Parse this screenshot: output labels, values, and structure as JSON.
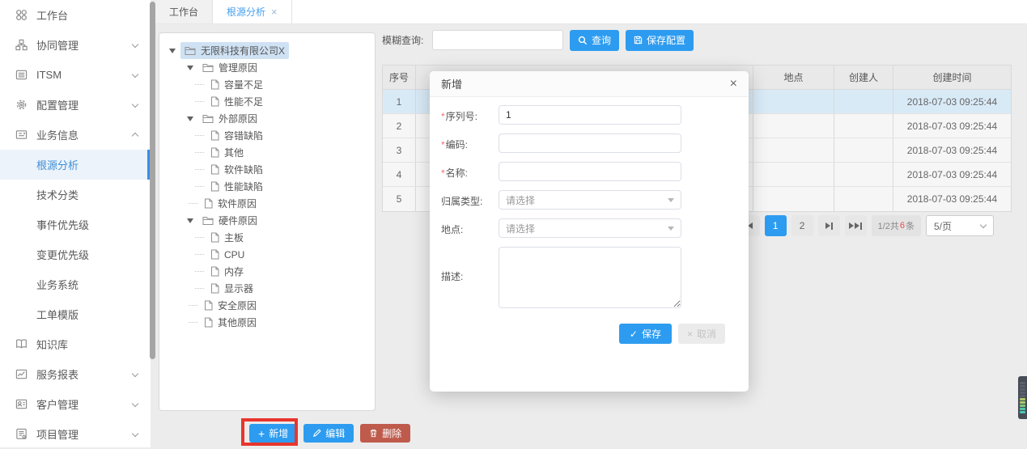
{
  "colors": {
    "accent": "#2d9cf0",
    "danger": "#bf5b4d",
    "annotation_red": "#e8352c",
    "active_blue": "#3d8fd8",
    "count_red": "#e84c4c"
  },
  "ui": {
    "required_mark": "*",
    "close": "×",
    "check": "✓",
    "cross": "×",
    "plus": "+"
  },
  "sidebar": {
    "items": [
      {
        "label": "工作台",
        "icon": "grid-icon"
      },
      {
        "label": "协同管理",
        "icon": "collab-icon",
        "chevron": "down"
      },
      {
        "label": "ITSM",
        "icon": "list-icon",
        "chevron": "down"
      },
      {
        "label": "配置管理",
        "icon": "gear-icon",
        "chevron": "down"
      },
      {
        "label": "业务信息",
        "icon": "business-icon",
        "chevron": "up",
        "expanded": true
      }
    ],
    "business_children": [
      "根源分析",
      "技术分类",
      "事件优先级",
      "变更优先级",
      "业务系统",
      "工单模版"
    ],
    "active_item": "根源分析",
    "tail_items": [
      {
        "label": "知识库",
        "icon": "book-icon"
      },
      {
        "label": "服务报表",
        "icon": "report-icon",
        "chevron": "down"
      },
      {
        "label": "客户管理",
        "icon": "customer-icon",
        "chevron": "down"
      },
      {
        "label": "项目管理",
        "icon": "project-icon",
        "chevron": "down"
      }
    ]
  },
  "tabs": {
    "first": "工作台",
    "active": "根源分析"
  },
  "tree": {
    "nodes": [
      {
        "label": "无限科技有限公司X",
        "type": "folder",
        "level": 0,
        "selected": true
      },
      {
        "label": "管理原因",
        "type": "folder",
        "level": 1
      },
      {
        "label": "容量不足",
        "type": "file",
        "level": 2
      },
      {
        "label": "性能不足",
        "type": "file",
        "level": 2
      },
      {
        "label": "外部原因",
        "type": "folder",
        "level": 1
      },
      {
        "label": "容错缺陷",
        "type": "file",
        "level": 2
      },
      {
        "label": "其他",
        "type": "file",
        "level": 2
      },
      {
        "label": "软件缺陷",
        "type": "file",
        "level": 2
      },
      {
        "label": "性能缺陷",
        "type": "file",
        "level": 2
      },
      {
        "label": "软件原因",
        "type": "file",
        "level": 1
      },
      {
        "label": "硬件原因",
        "type": "folder",
        "level": 1
      },
      {
        "label": "主板",
        "type": "file",
        "level": 2
      },
      {
        "label": "CPU",
        "type": "file",
        "level": 2
      },
      {
        "label": "内存",
        "type": "file",
        "level": 2
      },
      {
        "label": "显示器",
        "type": "file",
        "level": 2
      },
      {
        "label": "安全原因",
        "type": "file",
        "level": 1
      },
      {
        "label": "其他原因",
        "type": "file",
        "level": 1
      }
    ]
  },
  "tree_actions": {
    "add": "新增",
    "edit": "编辑",
    "remove": "删除"
  },
  "toolbar": {
    "search_label": "模糊查询:",
    "search_value": "",
    "query": "查询",
    "save_config": "保存配置"
  },
  "table": {
    "headers": {
      "seq": "序号",
      "location": "地点",
      "creator": "创建人",
      "created": "创建时间"
    },
    "rows": [
      {
        "seq": "1",
        "location": "",
        "creator": "",
        "created": "2018-07-03 09:25:44"
      },
      {
        "seq": "2",
        "location": "",
        "creator": "",
        "created": "2018-07-03 09:25:44"
      },
      {
        "seq": "3",
        "location": "",
        "creator": "",
        "created": "2018-07-03 09:25:44"
      },
      {
        "seq": "4",
        "location": "",
        "creator": "",
        "created": "2018-07-03 09:25:44"
      },
      {
        "seq": "5",
        "location": "",
        "creator": "",
        "created": "2018-07-03 09:25:44"
      }
    ]
  },
  "pagination": {
    "pages": [
      "1",
      "2"
    ],
    "current": "1",
    "info_prefix": "1/2共",
    "total": "6",
    "info_suffix": "条",
    "page_size": "5/页"
  },
  "modal": {
    "title": "新增",
    "fields": [
      {
        "label": "序列号:",
        "required": true,
        "type": "input",
        "value": "1"
      },
      {
        "label": "编码:",
        "required": true,
        "type": "input",
        "value": ""
      },
      {
        "label": "名称:",
        "required": true,
        "type": "input",
        "value": ""
      },
      {
        "label": "归属类型:",
        "required": false,
        "type": "select",
        "value": "请选择"
      },
      {
        "label": "地点:",
        "required": false,
        "type": "select",
        "value": "请选择"
      },
      {
        "label": "描述:",
        "required": false,
        "type": "textarea",
        "value": ""
      }
    ],
    "save": "保存",
    "cancel": "取消"
  }
}
